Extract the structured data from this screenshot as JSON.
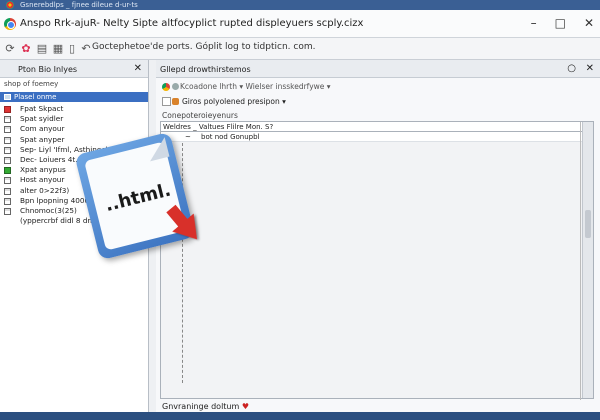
{
  "titlebar": {
    "text": "Gsnerebdlps _ fjnee dileue d-ur-ts"
  },
  "app": {
    "title": "Anspo Rrk-ajuR- Nelty Sipte altfocyplict rupted displeyuers scply.cizx"
  },
  "window_controls": {
    "minimize": "–",
    "maximize": "□",
    "close": "✕"
  },
  "toolbar": {
    "icons": [
      "refresh-icon",
      "palette-icon",
      "document-icon",
      "table-icon",
      "page-icon",
      "back-icon"
    ],
    "url": "Goctephetoe'de ports. Góplit log to tidpticn. com."
  },
  "left_panel": {
    "title": "Pton Bio Inlyes",
    "subtitle": "shop of foemey",
    "selected": "Plasel onme",
    "items": [
      {
        "label": "Fpat Skpact",
        "icon": "red"
      },
      {
        "label": "Spat syidler",
        "icon": "file"
      },
      {
        "label": "Com anyour",
        "icon": "file"
      },
      {
        "label": "Spat anyper",
        "icon": "file"
      },
      {
        "label": "Sep- Liyl 'Ifml, Asthinecb)",
        "icon": "file"
      },
      {
        "label": "Dec- Loiuers 4t.25350)",
        "icon": "file"
      },
      {
        "label": "Xpat anypus",
        "icon": "green"
      },
      {
        "label": "Host anyour",
        "icon": "file"
      },
      {
        "label": "alter 0>22f3)",
        "icon": "file"
      },
      {
        "label": "Bpn lpopning 4000)",
        "icon": "file"
      },
      {
        "label": "Chnomoc(3(25)",
        "icon": "file"
      },
      {
        "label": "(yppercrbf didl 8 dm",
        "icon": "none"
      }
    ]
  },
  "right_panel": {
    "title": "Gllepd drowthirstemos",
    "toolbar_text": "Kcoadone lhrth ▾  Wielser insskedrfywe ▾",
    "dropdown": "Giros polyolened presipon ▾",
    "section_label": "Conepoteroieyenurs",
    "table": {
      "header": "Weldres _ Valtues Flilre Mon. S?",
      "rows": [
        {
          "marker": "~",
          "text": "bot nod Gonupbl"
        }
      ]
    },
    "footer": "Gnvraninge doltum"
  },
  "badge": {
    "text": "..html."
  }
}
